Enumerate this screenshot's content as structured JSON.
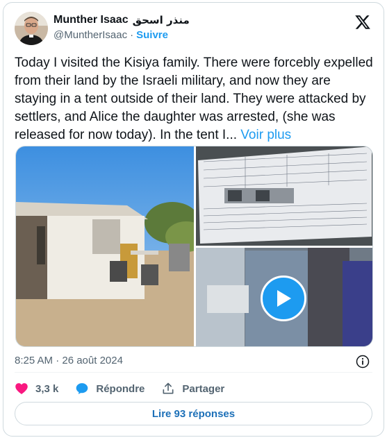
{
  "author": {
    "display_name": "Munther Isaac",
    "arabic_name": "منذر اسحق",
    "handle": "@MuntherIsaac",
    "separator": "·",
    "follow_label": "Suivre",
    "avatar_icon": "avatar-photo"
  },
  "platform_icon": "x-logo-icon",
  "tweet": {
    "text": "Today I visited the Kisiya family. There were forcebly expelled from their land by the Israeli military, and now they are staying in a tent outside of their land. They were attacked by settlers, and Alice the daughter was arrested, (she was released for now today). In the tent I...",
    "more_label": "Voir plus"
  },
  "media": {
    "items": [
      "tent-photo",
      "document-photo",
      "video-thumbnail"
    ],
    "play_icon": "play-icon"
  },
  "timestamp": "8:25 AM · 26 août 2024",
  "actions": {
    "like_count": "3,3 k",
    "reply_label": "Répondre",
    "share_label": "Partager"
  },
  "replies_button": "Lire 93 réponses",
  "colors": {
    "accent": "#1d9bf0",
    "like": "#f91880",
    "text": "#0f1419",
    "muted": "#536471"
  }
}
